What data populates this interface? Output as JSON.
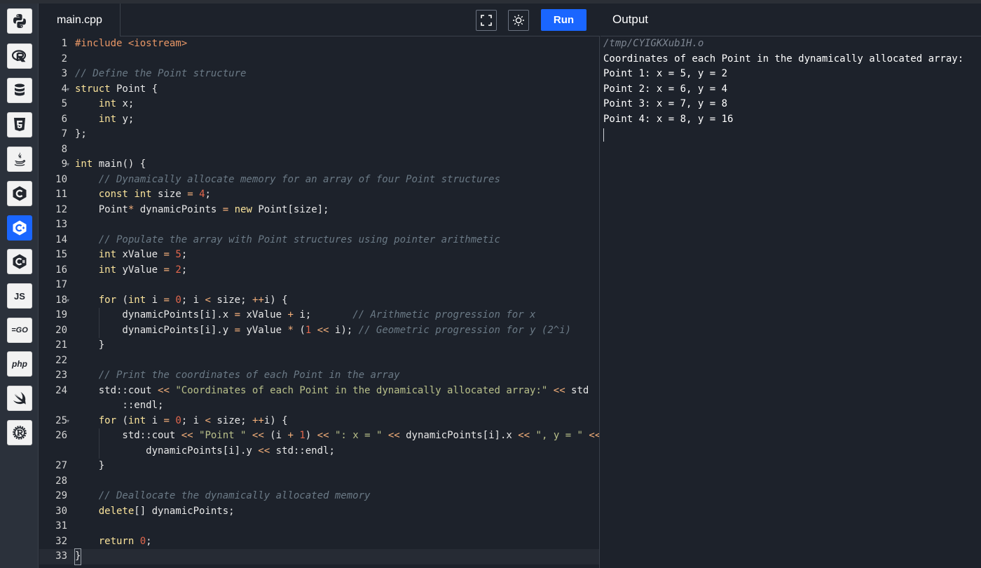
{
  "sidebar": {
    "languages": [
      {
        "icon": "python-icon",
        "active": false
      },
      {
        "icon": "r-icon",
        "active": false
      },
      {
        "icon": "database-icon",
        "active": false
      },
      {
        "icon": "html5-icon",
        "active": false
      },
      {
        "icon": "java-icon",
        "active": false
      },
      {
        "icon": "c-icon",
        "active": false
      },
      {
        "icon": "cpp-icon",
        "active": true
      },
      {
        "icon": "csharp-icon",
        "active": false
      },
      {
        "icon": "js-icon",
        "label": "JS",
        "active": false
      },
      {
        "icon": "go-icon",
        "label": "GO",
        "active": false
      },
      {
        "icon": "php-icon",
        "label": "php",
        "active": false
      },
      {
        "icon": "swift-icon",
        "active": false
      },
      {
        "icon": "rust-icon",
        "active": false
      }
    ],
    "accent_color": "#1a66ff"
  },
  "editor": {
    "file_tab": "main.cpp",
    "run_label": "Run",
    "fullscreen_icon": "fullscreen-icon",
    "theme_icon": "sun-icon",
    "line_numbers": [
      "1",
      "2",
      "3",
      "4",
      "5",
      "6",
      "7",
      "8",
      "9",
      "10",
      "11",
      "12",
      "13",
      "14",
      "15",
      "16",
      "17",
      "18",
      "19",
      "20",
      "21",
      "22",
      "23",
      "24",
      "",
      "25",
      "26",
      "",
      "27",
      "28",
      "29",
      "30",
      "31",
      "32",
      "33"
    ],
    "fold_lines": [
      "4",
      "9",
      "18",
      "25"
    ],
    "active_line": "33",
    "code_lines": [
      "#include <iostream>",
      "",
      "// Define the Point structure",
      "struct Point {",
      "    int x;",
      "    int y;",
      "};",
      "",
      "int main() {",
      "    // Dynamically allocate memory for an array of four Point structures",
      "    const int size = 4;",
      "    Point* dynamicPoints = new Point[size];",
      "",
      "    // Populate the array with Point structures using pointer arithmetic",
      "    int xValue = 5;",
      "    int yValue = 2;",
      "",
      "    for (int i = 0; i < size; ++i) {",
      "        dynamicPoints[i].x = xValue + i;       // Arithmetic progression for x",
      "        dynamicPoints[i].y = yValue * (1 << i); // Geometric progression for y (2^i)",
      "    }",
      "",
      "    // Print the coordinates of each Point in the array",
      "    std::cout << \"Coordinates of each Point in the dynamically allocated array:\" << std",
      "        ::endl;",
      "    for (int i = 0; i < size; ++i) {",
      "        std::cout << \"Point \" << (i + 1) << \": x = \" << dynamicPoints[i].x << \", y = \" <<",
      "            dynamicPoints[i].y << std::endl;",
      "    }",
      "",
      "    // Deallocate the dynamically allocated memory",
      "    delete[] dynamicPoints;",
      "",
      "    return 0;",
      "}"
    ]
  },
  "output": {
    "title": "Output",
    "path": "/tmp/CYIGKXub1H.o",
    "lines": [
      "Coordinates of each Point in the dynamically allocated array:",
      "Point 1: x = 5, y = 2",
      "Point 2: x = 6, y = 4",
      "Point 3: x = 7, y = 8",
      "Point 4: x = 8, y = 16"
    ]
  }
}
